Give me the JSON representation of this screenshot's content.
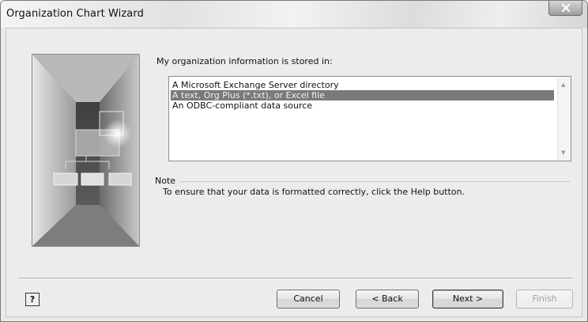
{
  "window": {
    "title": "Organization Chart Wizard",
    "close_glyph": "X"
  },
  "prompt": "My organization information is stored in:",
  "list": {
    "items": [
      {
        "label": "A Microsoft Exchange Server directory",
        "selected": false
      },
      {
        "label": "A text, Org Plus (*.txt), or Excel file",
        "selected": true
      },
      {
        "label": "An ODBC-compliant data source",
        "selected": false
      }
    ],
    "scroll_up_glyph": "▲",
    "scroll_down_glyph": "▼"
  },
  "note": {
    "label": "Note",
    "text": "To ensure that your data is formatted correctly, click the Help button."
  },
  "help_button": {
    "glyph": "?",
    "icon": "help-icon"
  },
  "buttons": {
    "cancel": "Cancel",
    "back": "< Back",
    "next": "Next >",
    "finish": "Finish"
  },
  "colors": {
    "selection": "#7a7a7a",
    "dialog_bg": "#ececec"
  }
}
